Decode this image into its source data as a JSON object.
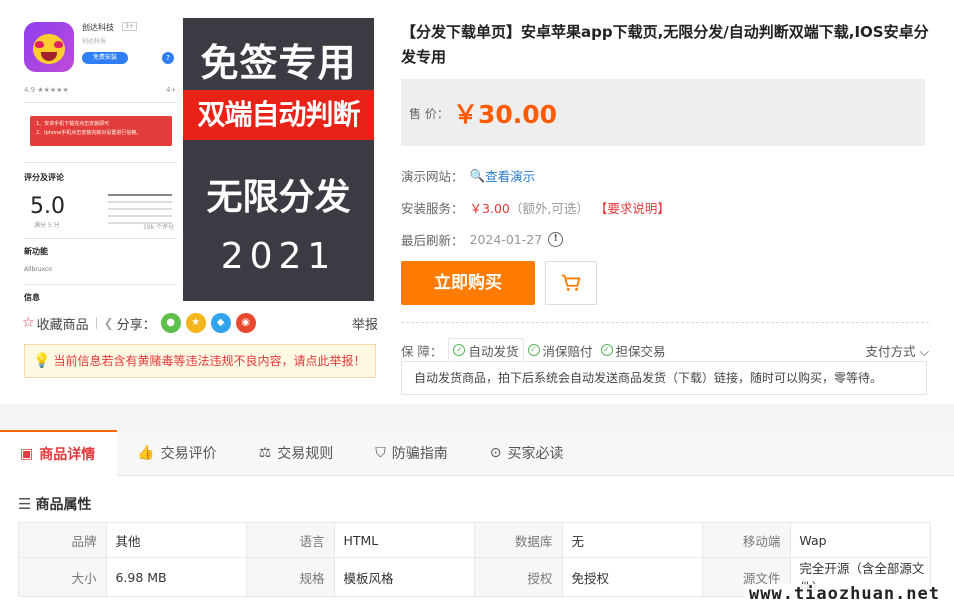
{
  "gallery": {
    "screenshot": {
      "app_name": "创达科技",
      "app_tag": "3+",
      "app_sub": "创达科技",
      "free_button": "免费安装",
      "rating_line": "4.9 ★★★★★",
      "age": "4+",
      "notice_lines": [
        "1、安卓手机下载完点击安装即可",
        "2、Iphone手机点击安装完就对设置进行信赖。"
      ],
      "reviews_title": "评分及评论",
      "score": "5.0",
      "score_sub": "满分 5 分",
      "ratings_count": "19k 个评分",
      "new_features_title": "新功能",
      "new_features_sub": "Allbruxco",
      "info_title": "信息"
    },
    "poster": {
      "line1": "免签专用",
      "line2": "双端自动判断",
      "line3": "无限分发",
      "line4": "2021"
    }
  },
  "actions": {
    "favorite": "收藏商品",
    "share": "分享：",
    "report": "举报"
  },
  "warning": "当前信息若含有黄赌毒等违法违规不良内容，请点此举报！",
  "product": {
    "title": "【分发下载单页】安卓苹果app下载页,无限分发/自动判断双端下载,IOS安卓分发专用",
    "price_label": "售 价：",
    "price": "￥30.00",
    "demo_label": "演示网站：",
    "demo_link": "查看演示",
    "install_label": "安装服务：",
    "install_price": "￥3.00",
    "install_note": "（额外,可选）",
    "install_req": "【要求说明】",
    "refresh_label": "最后刷新：",
    "refresh_date": "2024-01-27",
    "buy_button": "立即购买",
    "guarantee_label": "保  障：",
    "guarantees": [
      "自动发货",
      "消保赔付",
      "担保交易"
    ],
    "pay_methods": "支付方式",
    "guarantee_desc": "自动发货商品，拍下后系统会自动发送商品发货（下载）链接，随时可以购买，零等待。"
  },
  "tabs": [
    "商品详情",
    "交易评价",
    "交易规则",
    "防骗指南",
    "买家必读"
  ],
  "attributes": {
    "title": "商品属性",
    "rows": [
      [
        [
          "品牌",
          "其他"
        ],
        [
          "语言",
          "HTML"
        ],
        [
          "数据库",
          "无"
        ],
        [
          "移动端",
          "Wap"
        ]
      ],
      [
        [
          "大小",
          "6.98 MB"
        ],
        [
          "规格",
          "模板风格"
        ],
        [
          "授权",
          "免授权"
        ],
        [
          "源文件",
          "完全开源（含全部源文件）"
        ]
      ]
    ]
  },
  "watermark": "www.tiaozhuan.net",
  "colors": {
    "accent": "#ff7c00",
    "price": "#ff5b00",
    "link": "#2a78c8",
    "warn": "#e4393c"
  }
}
